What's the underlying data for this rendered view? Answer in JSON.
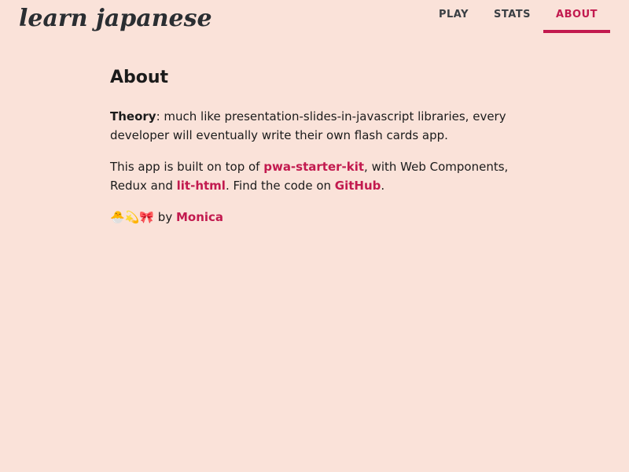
{
  "app": {
    "logo_text": "learn japanese"
  },
  "nav": {
    "items": [
      {
        "label": "PLAY"
      },
      {
        "label": "STATS"
      },
      {
        "label": "ABOUT"
      }
    ],
    "selected": "ABOUT",
    "accent_color": "#c21a4f"
  },
  "page": {
    "title": "About",
    "theory_label": "Theory",
    "theory_text": ": much like presentation-slides-in-javascript libraries, every developer will eventually write their own flash cards app.",
    "built_prefix": "This app is built on top of ",
    "link_pwa": "pwa-starter-kit",
    "built_middle": ", with Web Components, Redux and ",
    "link_lit": "lit-html",
    "built_suffix": ". Find the code on ",
    "link_github": "GitHub",
    "built_end": ".",
    "emojis": "🐣💫🎀",
    "by_text": " by ",
    "link_author": "Monica"
  },
  "colors": {
    "background": "#fae2d9",
    "text": "#1b1b1b"
  }
}
